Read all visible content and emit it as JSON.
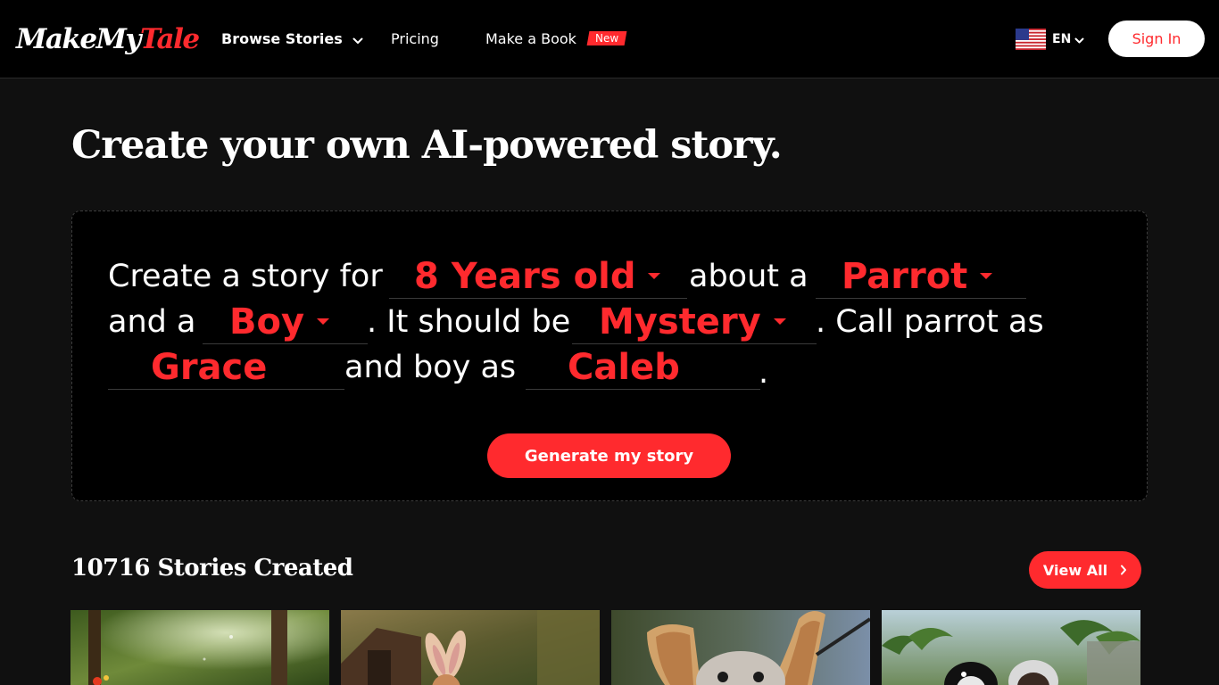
{
  "header": {
    "logo_part1": "MakeMy",
    "logo_part2": "Tale",
    "nav": {
      "browse_label": "Browse Stories",
      "pricing_label": "Pricing",
      "book_label": "Make a Book",
      "book_badge": "New"
    },
    "language": {
      "code": "EN",
      "flag_icon": "us-flag-icon"
    },
    "signin_label": "Sign In"
  },
  "hero": {
    "title": "Create your own AI-powered story.",
    "sentence": {
      "t1": "Create a story for",
      "age_value": "8 Years old",
      "t2": "about a",
      "animal_value": "Parrot",
      "t3": "and a",
      "companion_value": "Boy",
      "t4": ". It should be",
      "genre_value": "Mystery",
      "t5": ". Call parrot as",
      "animal_name_value": "Grace",
      "t6": "and boy as",
      "companion_name_value": "Caleb",
      "t7": "."
    },
    "generate_label": "Generate my story"
  },
  "stories": {
    "count_label": "10716 Stories Created",
    "view_all_label": "View All",
    "thumbnails": [
      {
        "scene": "forest-clearing"
      },
      {
        "scene": "bunny-boy-cottage"
      },
      {
        "scene": "bat-creature"
      },
      {
        "scene": "tropical-beach-characters"
      }
    ]
  },
  "colors": {
    "accent": "#ff2a2e",
    "background": "#101010",
    "header_bg": "#000000",
    "text": "#ffffff"
  }
}
